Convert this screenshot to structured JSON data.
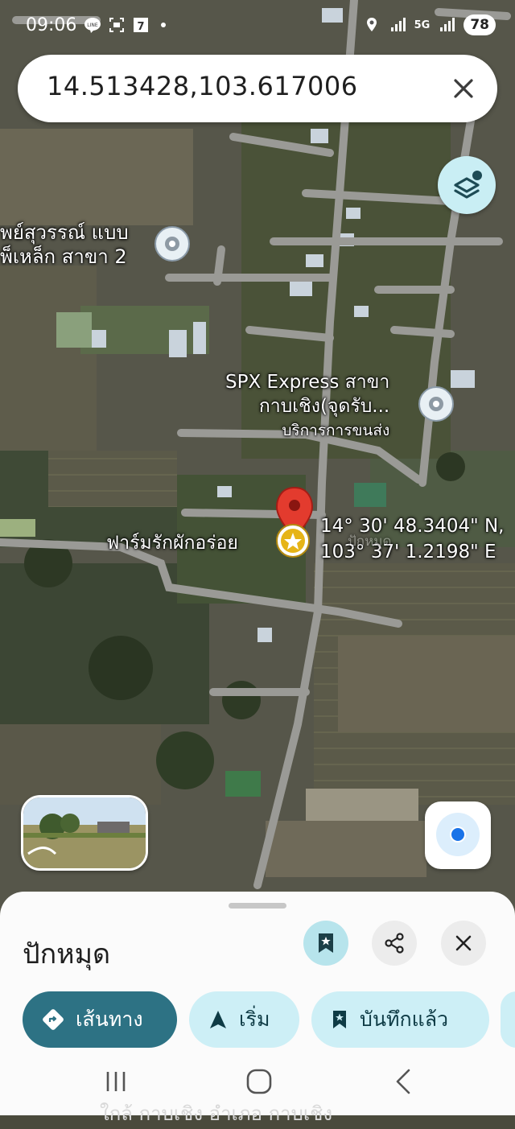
{
  "status_bar": {
    "time": "09:06",
    "network": "5G",
    "battery": "78"
  },
  "search": {
    "query": "14.513428,103.617006"
  },
  "map": {
    "labels": {
      "top_left_line1": "พย์สุวรรณ์ แบบ",
      "top_left_line2": "พ็เหล็ก สาขา 2",
      "spx_line1": "SPX Express สาขา",
      "spx_line2": "กาบเชิง(จุดรับ...",
      "spx_line3": "บริการการขนส่ง",
      "farm": "ฟาร์มรักผักอร่อย",
      "coord_line1": "14° 30' 48.3404\" N,",
      "coord_line2": "103° 37' 1.2198\" E",
      "faint_map_text": "ปักหมุด"
    }
  },
  "sheet": {
    "title": "ปักหมุด",
    "chips": {
      "directions": "เส้นทาง",
      "start": "เริ่ม",
      "saved": "บันทึกแล้ว"
    },
    "faded_subtitle": "ใกล้ กาบเชิง อำเภอ กาบเชิง"
  },
  "colors": {
    "accent": "#2d7284",
    "tonal": "#cdeff6",
    "pin_red": "#e33b2e",
    "location_blue": "#1a73e8"
  }
}
